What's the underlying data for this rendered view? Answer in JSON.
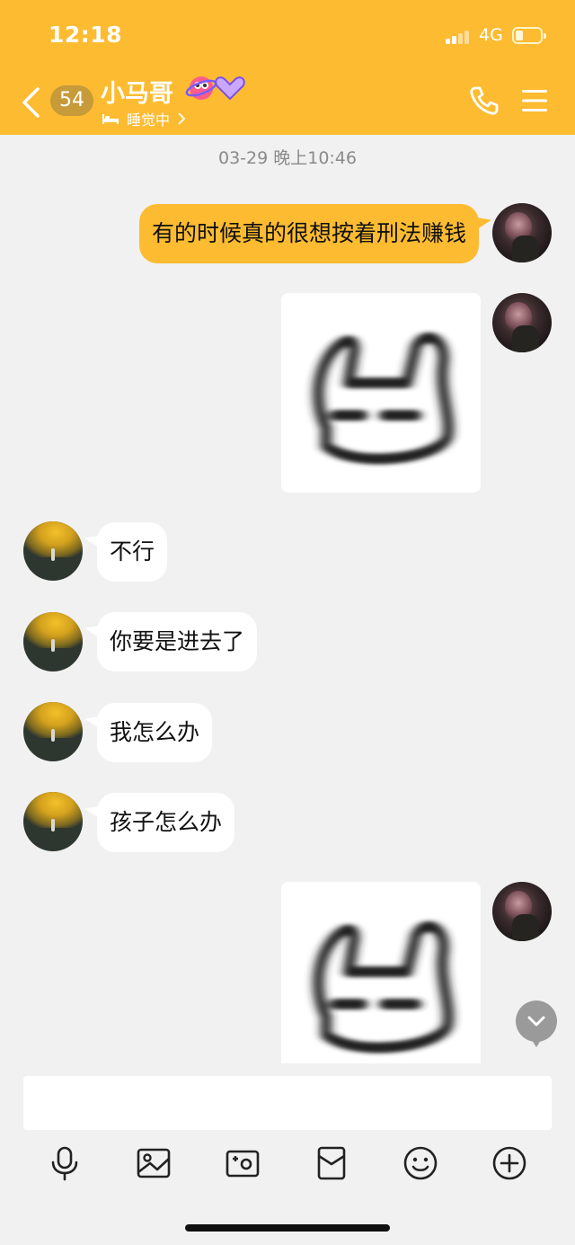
{
  "status_bar": {
    "time": "12:18",
    "network": "4G"
  },
  "header": {
    "unread_count": "54",
    "contact_name": "小马哥",
    "status_text": "睡觉中",
    "bg_color": "#fdbb31"
  },
  "chat": {
    "timestamp": "03-29 晚上10:46",
    "messages": [
      {
        "from": "me",
        "type": "text",
        "text": "有的时候真的很想按着刑法赚钱"
      },
      {
        "from": "me",
        "type": "sticker",
        "sticker": "blurry-bunny"
      },
      {
        "from": "other",
        "type": "text",
        "text": "不行"
      },
      {
        "from": "other",
        "type": "text",
        "text": "你要是进去了"
      },
      {
        "from": "other",
        "type": "text",
        "text": "我怎么办"
      },
      {
        "from": "other",
        "type": "text",
        "text": "孩子怎么办"
      },
      {
        "from": "me",
        "type": "sticker",
        "sticker": "blurry-bunny"
      }
    ]
  },
  "input": {
    "value": "",
    "placeholder": ""
  },
  "toolbar": {
    "icons": [
      "microphone-icon",
      "image-icon",
      "camera-icon",
      "red-packet-icon",
      "emoji-icon",
      "plus-icon"
    ]
  }
}
